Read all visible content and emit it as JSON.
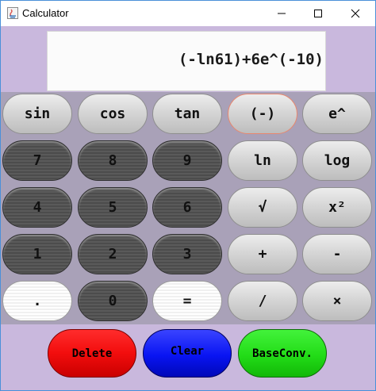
{
  "window": {
    "title": "Calculator"
  },
  "display": {
    "expression": "(-ln61)+6e^(-10)"
  },
  "keypad": {
    "rows": [
      [
        "sin",
        "cos",
        "tan",
        "(-)",
        "e^"
      ],
      [
        "7",
        "8",
        "9",
        "ln",
        "log"
      ],
      [
        "4",
        "5",
        "6",
        "√",
        "x²"
      ],
      [
        "1",
        "2",
        "3",
        "+",
        "-"
      ],
      [
        ".",
        "0",
        "=",
        "/",
        "×"
      ]
    ]
  },
  "bottom": {
    "delete": "Delete",
    "clear": "Clear",
    "baseconv": "BaseConv."
  },
  "colors": {
    "background": "#c9b8dd",
    "keypad_background": "#a9a1b8",
    "delete_button": "#f20d0d",
    "clear_button": "#0914f2",
    "baseconv_button": "#22dc17",
    "focused_outline": "#e8876e"
  }
}
